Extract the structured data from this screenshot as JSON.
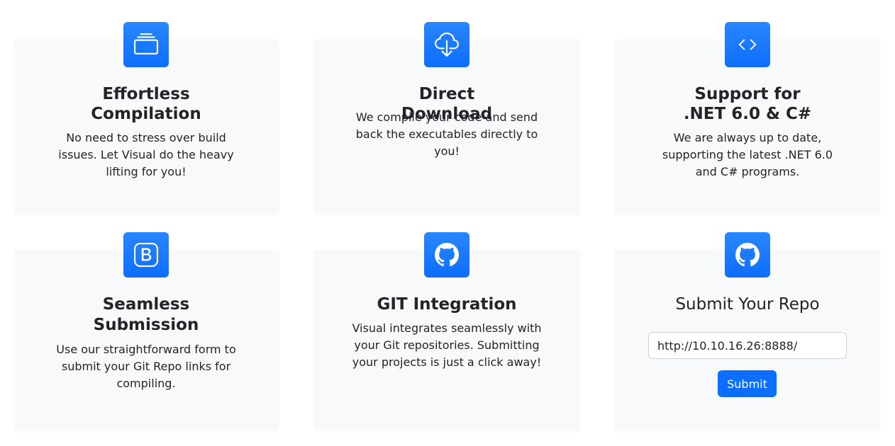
{
  "accent_color": "#0d6efd",
  "card_background": "#f8f9fa",
  "features": [
    {
      "icon": "collection-icon",
      "title": "Effortless Compilation",
      "description": "No need to stress over build issues. Let Visual do the heavy lifting for you!"
    },
    {
      "icon": "cloud-download-icon",
      "title": "Direct Download",
      "description": "We compile your code and send back the executables directly to you!"
    },
    {
      "icon": "code-icon",
      "title": "Support for .NET 6.0 & C#",
      "description": "We are always up to date, supporting the latest .NET 6.0 and C# programs."
    },
    {
      "icon": "bootstrap-icon",
      "title": "Seamless Submission",
      "description": "Use our straightforward form to submit your Git Repo links for compiling."
    },
    {
      "icon": "github-icon",
      "title": "GIT Integration",
      "description": "Visual integrates seamlessly with your Git repositories. Submitting your projects is just a click away!"
    }
  ],
  "submit_card": {
    "icon": "github-icon",
    "title": "Submit Your Repo",
    "input_value": "http://10.10.16.26:8888/",
    "button_label": "Submit"
  }
}
